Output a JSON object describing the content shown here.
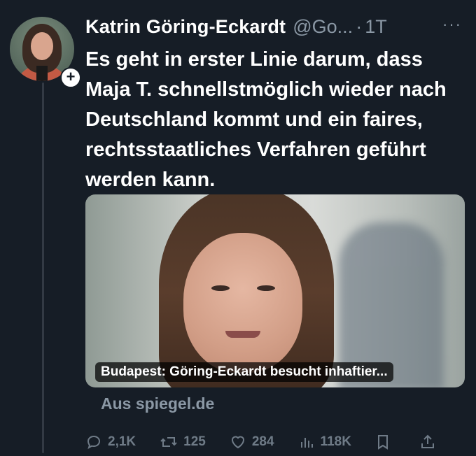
{
  "tweet": {
    "author_name": "Katrin Göring-Eckardt",
    "handle": "@Go...",
    "separator": "·",
    "time": "1T",
    "more": "···",
    "follow_symbol": "+",
    "text": "Es geht in erster Linie darum, dass Maja T. schnellstmöglich wieder nach Deutschland kommt und ein faires, rechtsstaatliches Verfahren geführt werden kann.",
    "card": {
      "title": "Budapest: Göring-Eckardt besucht inhaftier...",
      "source": "Aus spiegel.de"
    },
    "actions": {
      "replies": "2,1K",
      "reposts": "125",
      "likes": "284",
      "views": "118K"
    }
  }
}
